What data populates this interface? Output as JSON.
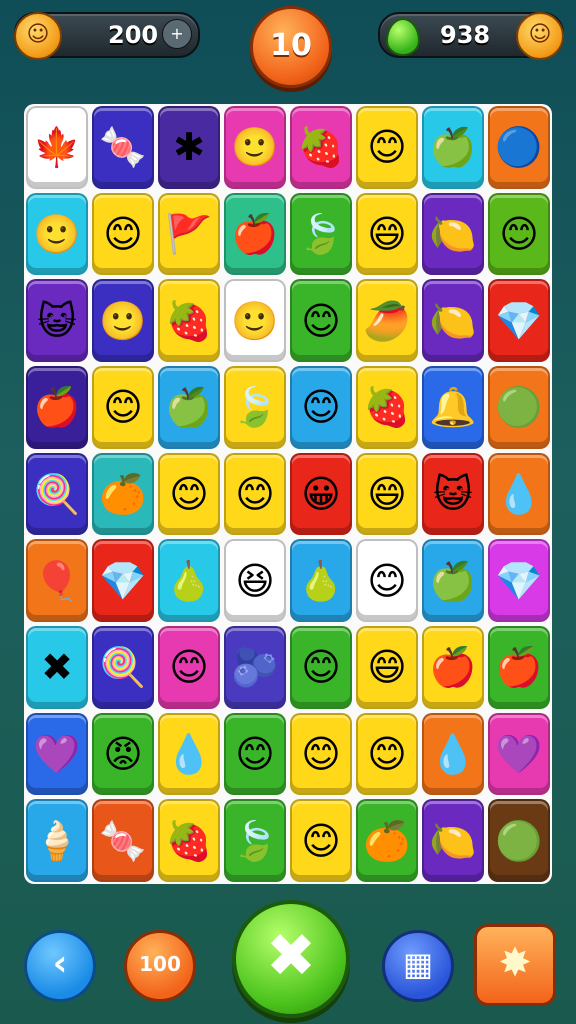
{
  "hud": {
    "coins": "200",
    "plus": "+",
    "level": "10",
    "gems": "938",
    "coin_face": "☺",
    "gem_face": "☺"
  },
  "board": {
    "rows": [
      [
        {
          "c": "#ffffff",
          "s": "🍁"
        },
        {
          "c": "#3a2fc0",
          "s": "🍬"
        },
        {
          "c": "#4a2aa0",
          "s": "✱"
        },
        {
          "c": "#e83ab0",
          "s": "🙂"
        },
        {
          "c": "#e83ab0",
          "s": "🍓"
        },
        {
          "c": "#ffd81a",
          "s": "😊"
        },
        {
          "c": "#28c8e8",
          "s": "🍏"
        },
        {
          "c": "#f2751a",
          "s": "🔵"
        }
      ],
      [
        {
          "c": "#28c8e8",
          "s": "🙂"
        },
        {
          "c": "#ffd81a",
          "s": "😊"
        },
        {
          "c": "#ffd81a",
          "s": "🚩"
        },
        {
          "c": "#2ec08a",
          "s": "🍎"
        },
        {
          "c": "#3ab52a",
          "s": "🍃"
        },
        {
          "c": "#ffd81a",
          "s": "😄"
        },
        {
          "c": "#6a2ac0",
          "s": "🍋"
        },
        {
          "c": "#5ab81a",
          "s": "😊"
        }
      ],
      [
        {
          "c": "#6a2ac0",
          "s": "😺"
        },
        {
          "c": "#3a2fc0",
          "s": "🙂"
        },
        {
          "c": "#ffd81a",
          "s": "🍓"
        },
        {
          "c": "#ffffff",
          "s": "🙂"
        },
        {
          "c": "#3ab52a",
          "s": "😊"
        },
        {
          "c": "#ffd81a",
          "s": "🥭"
        },
        {
          "c": "#6a2ac0",
          "s": "🍋"
        },
        {
          "c": "#e8261a",
          "s": "💎"
        }
      ],
      [
        {
          "c": "#3a1f9a",
          "s": "🍎"
        },
        {
          "c": "#ffd81a",
          "s": "😊"
        },
        {
          "c": "#28a8e8",
          "s": "🍏"
        },
        {
          "c": "#ffd81a",
          "s": "🍃"
        },
        {
          "c": "#28a8e8",
          "s": "😊"
        },
        {
          "c": "#ffd81a",
          "s": "🍓"
        },
        {
          "c": "#2a6ae8",
          "s": "🔔"
        },
        {
          "c": "#f2751a",
          "s": "🟢"
        }
      ],
      [
        {
          "c": "#3a2fc0",
          "s": "🍭"
        },
        {
          "c": "#2ab8b8",
          "s": "🍊"
        },
        {
          "c": "#ffd81a",
          "s": "😊"
        },
        {
          "c": "#ffd81a",
          "s": "😊"
        },
        {
          "c": "#e8261a",
          "s": "😀"
        },
        {
          "c": "#ffd81a",
          "s": "😄"
        },
        {
          "c": "#e8261a",
          "s": "😺"
        },
        {
          "c": "#f2751a",
          "s": "💧"
        }
      ],
      [
        {
          "c": "#f2751a",
          "s": "🎈"
        },
        {
          "c": "#e8261a",
          "s": "💎"
        },
        {
          "c": "#28c8e8",
          "s": "🍐"
        },
        {
          "c": "#ffffff",
          "s": "😆"
        },
        {
          "c": "#28a8e8",
          "s": "🍐"
        },
        {
          "c": "#ffffff",
          "s": "😊"
        },
        {
          "c": "#28a8e8",
          "s": "🍏"
        },
        {
          "c": "#d83ae8",
          "s": "💎"
        }
      ],
      [
        {
          "c": "#28c8e8",
          "s": "✖"
        },
        {
          "c": "#3a2fc0",
          "s": "🍭"
        },
        {
          "c": "#e83ab0",
          "s": "😊"
        },
        {
          "c": "#4a3ac0",
          "s": "🫐"
        },
        {
          "c": "#3ab52a",
          "s": "😊"
        },
        {
          "c": "#ffd81a",
          "s": "😄"
        },
        {
          "c": "#ffd81a",
          "s": "🍎"
        },
        {
          "c": "#3ab52a",
          "s": "🍎"
        }
      ],
      [
        {
          "c": "#2a6ae8",
          "s": "💜"
        },
        {
          "c": "#3ab52a",
          "s": "😡"
        },
        {
          "c": "#ffd81a",
          "s": "💧"
        },
        {
          "c": "#3ab52a",
          "s": "😊"
        },
        {
          "c": "#ffd81a",
          "s": "😊"
        },
        {
          "c": "#ffd81a",
          "s": "😊"
        },
        {
          "c": "#f2751a",
          "s": "💧"
        },
        {
          "c": "#e83ab0",
          "s": "💜"
        }
      ],
      [
        {
          "c": "#28a8e8",
          "s": "🍦"
        },
        {
          "c": "#e8561a",
          "s": "🍬"
        },
        {
          "c": "#ffd81a",
          "s": "🍓"
        },
        {
          "c": "#3ab52a",
          "s": "🍃"
        },
        {
          "c": "#ffd81a",
          "s": "😊"
        },
        {
          "c": "#3ab52a",
          "s": "🍊"
        },
        {
          "c": "#6a2ac0",
          "s": "🍋"
        },
        {
          "c": "#6a3a14",
          "s": "🟢"
        }
      ]
    ]
  },
  "controls": {
    "back": "‹",
    "score": "100",
    "shuffle": "✖",
    "menu": "▦",
    "hint": "✸"
  }
}
